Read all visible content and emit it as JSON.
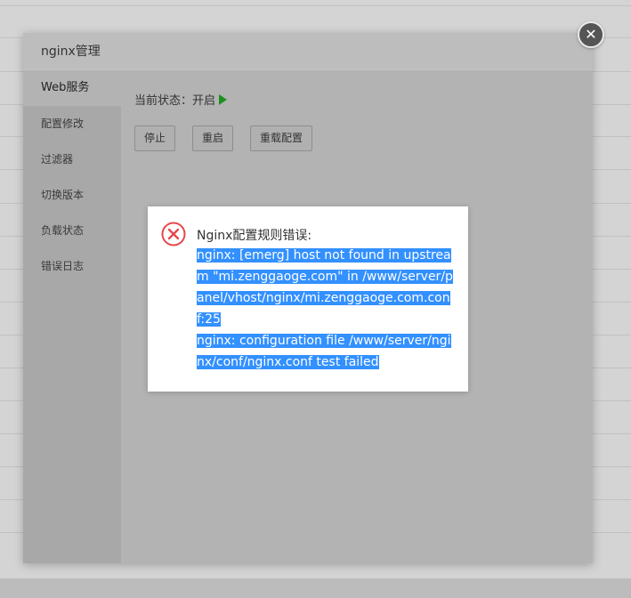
{
  "modal": {
    "title": "nginx管理",
    "close_glyph": "✕"
  },
  "sidebar": {
    "items": [
      {
        "label": "Web服务",
        "active": true
      },
      {
        "label": "配置修改"
      },
      {
        "label": "过滤器"
      },
      {
        "label": "切换版本"
      },
      {
        "label": "负载状态"
      },
      {
        "label": "错误日志"
      }
    ]
  },
  "content": {
    "status_label": "当前状态：开启",
    "status_icon": "play-icon",
    "buttons": {
      "stop": "停止",
      "restart": "重启",
      "reload": "重载配置"
    }
  },
  "error_dialog": {
    "icon": "error-circle-icon",
    "icon_color": "#e5484d",
    "title": "Nginx配置规则错误:",
    "message_line1": "nginx: [emerg] host not found in upstream \"mi.zenggaoge.com\" in /www/server/panel/vhost/nginx/mi.zenggaoge.com.conf:25",
    "message_line2": "nginx: configuration file /www/server/nginx/conf/nginx.conf test failed",
    "selection_color": "#3390ff"
  }
}
